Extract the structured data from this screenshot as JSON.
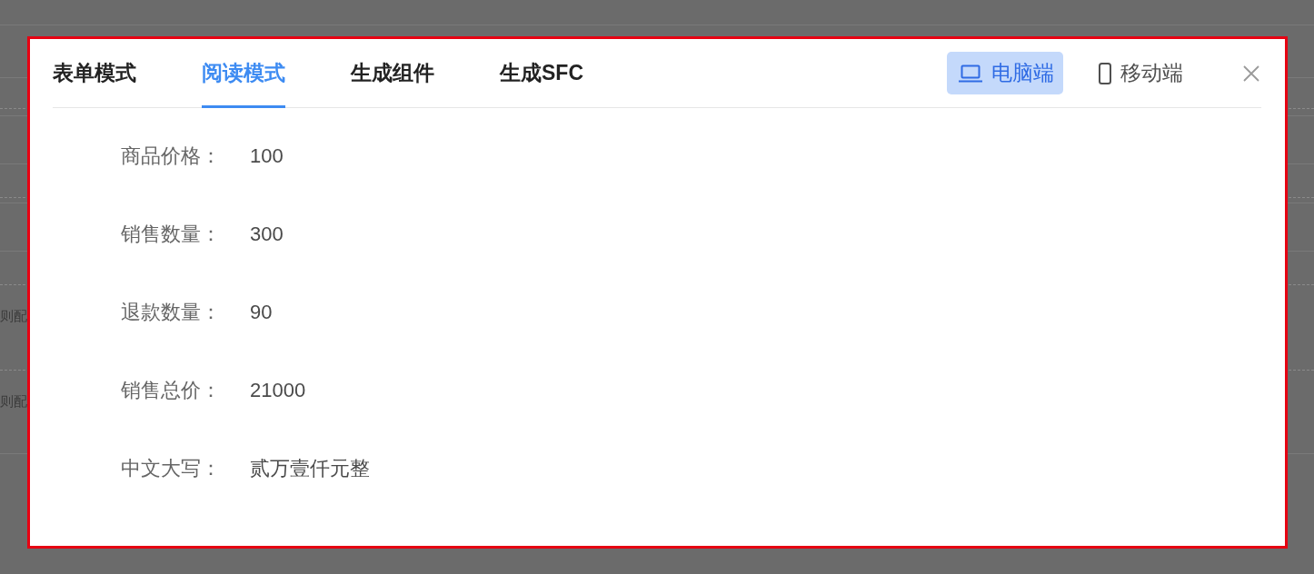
{
  "background": {
    "row_fragments": [
      "则配",
      "则配"
    ]
  },
  "dialog": {
    "tabs": [
      {
        "label": "表单模式",
        "selected": false
      },
      {
        "label": "阅读模式",
        "selected": true
      },
      {
        "label": "生成组件",
        "selected": false
      },
      {
        "label": "生成SFC",
        "selected": false
      }
    ],
    "device_switch": [
      {
        "kind": "desktop",
        "label": "电脑端",
        "selected": true
      },
      {
        "kind": "mobile",
        "label": "移动端",
        "selected": false
      }
    ],
    "fields": [
      {
        "label": "商品价格：",
        "value": "100"
      },
      {
        "label": "销售数量：",
        "value": "300"
      },
      {
        "label": "退款数量：",
        "value": "90"
      },
      {
        "label": "销售总价：",
        "value": "21000"
      },
      {
        "label": "中文大写：",
        "value": "贰万壹仟元整"
      }
    ]
  }
}
